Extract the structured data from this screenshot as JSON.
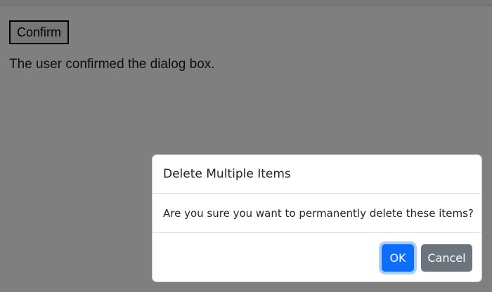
{
  "page": {
    "confirm_label": "Confirm",
    "result_text": "The user confirmed the dialog box."
  },
  "dialog": {
    "title": "Delete Multiple Items",
    "message": "Are you sure you want to permanently delete these items?",
    "ok_label": "OK",
    "cancel_label": "Cancel"
  },
  "colors": {
    "primary": "#0d6efd",
    "secondary": "#6c757d",
    "backdrop": "rgba(0,0,0,0.5)"
  }
}
